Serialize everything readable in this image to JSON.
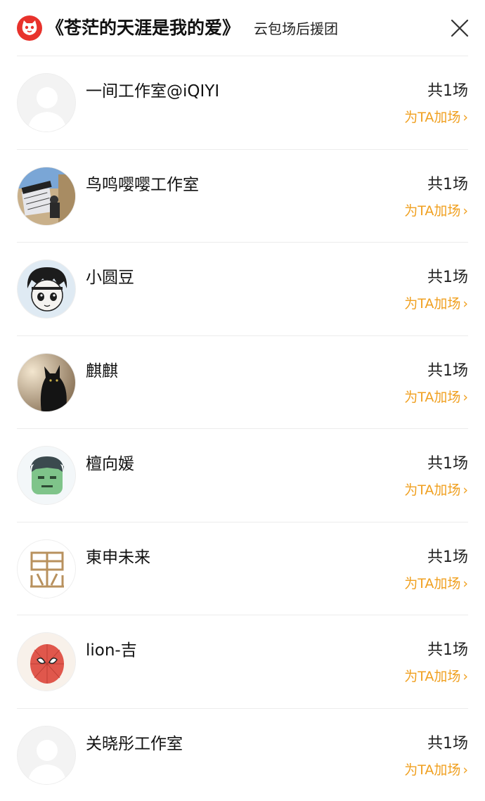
{
  "header": {
    "title": "《苍茫的天涯是我的爱》",
    "subtitle": "云包场后援团"
  },
  "supporters": [
    {
      "name": "一间工作室@iQIYI",
      "count": "共1场",
      "action": "为TA加场",
      "avatar": "default-avatar-icon"
    },
    {
      "name": "鸟鸣嘤嘤工作室",
      "count": "共1场",
      "action": "为TA加场",
      "avatar": "clapperboard-photo"
    },
    {
      "name": "小圆豆",
      "count": "共1场",
      "action": "为TA加场",
      "avatar": "cartoon-boy-drawing"
    },
    {
      "name": "麒麒",
      "count": "共1场",
      "action": "为TA加场",
      "avatar": "black-cat-photo"
    },
    {
      "name": "檀向媛",
      "count": "共1场",
      "action": "为TA加场",
      "avatar": "green-hulk-icon"
    },
    {
      "name": "東申未来",
      "count": "共1场",
      "action": "为TA加场",
      "avatar": "seal-logo"
    },
    {
      "name": "lion-吉",
      "count": "共1场",
      "action": "为TA加场",
      "avatar": "spiderman-icon"
    },
    {
      "name": "关晓彤工作室",
      "count": "共1场",
      "action": "为TA加场",
      "avatar": "default-avatar-icon"
    }
  ],
  "colors": {
    "accent": "#f0a020",
    "brand_red": "#e8322c",
    "divider": "#ececec"
  }
}
